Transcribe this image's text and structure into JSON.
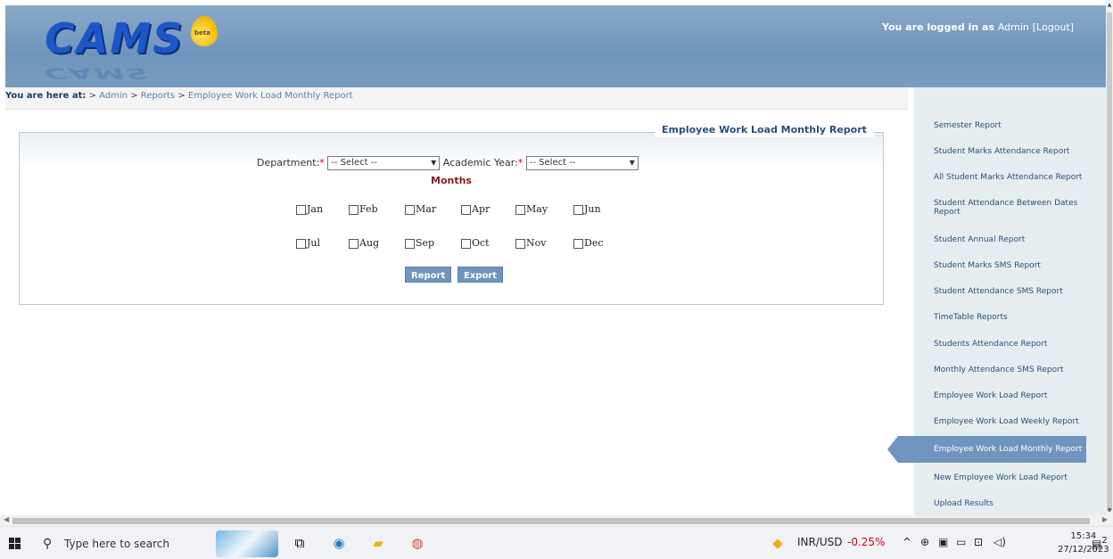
{
  "header": {
    "logo_text": "CAMS",
    "logo_badge": "beta",
    "login_prefix": "You are logged in as",
    "user": "Admin",
    "logout": "[Logout]"
  },
  "breadcrumb": {
    "prefix": "You are here at:",
    "sep": ">",
    "items": [
      "Admin",
      "Reports",
      "Employee Work Load Monthly Report"
    ]
  },
  "panel": {
    "title": "Employee Work Load Monthly Report",
    "department_label": "Department:",
    "department_value": "-- Select --",
    "year_label": "Academic Year:",
    "year_value": "-- Select --",
    "required_mark": "*",
    "months_title": "Months",
    "months": [
      "Jan",
      "Feb",
      "Mar",
      "Apr",
      "May",
      "Jun",
      "Jul",
      "Aug",
      "Sep",
      "Oct",
      "Nov",
      "Dec"
    ],
    "report_button": "Report",
    "export_button": "Export"
  },
  "sidebar": {
    "items": [
      "Semester Report",
      "Student Marks Attendance Report",
      "All Student Marks Attendance Report",
      "Student Attendance Between Dates Report",
      "Student Annual Report",
      "Student Marks SMS Report",
      "Student Attendance SMS Report",
      "TimeTable Reports",
      "Students Attendance Report",
      "Monthly Attendance SMS Report",
      "Employee Work Load Report",
      "Employee Work Load Weekly Report",
      "Employee Work Load Monthly Report",
      "New Employee Work Load Report",
      "Upload Results"
    ],
    "active_index": 12
  },
  "taskbar": {
    "search_placeholder": "Type here to search",
    "ticker": "INR/USD",
    "ticker_change": "-0.25%",
    "time": "15:34",
    "date": "27/12/2023",
    "notification_count": "2",
    "colors": {
      "ticker_negative": "#d0021b"
    }
  }
}
